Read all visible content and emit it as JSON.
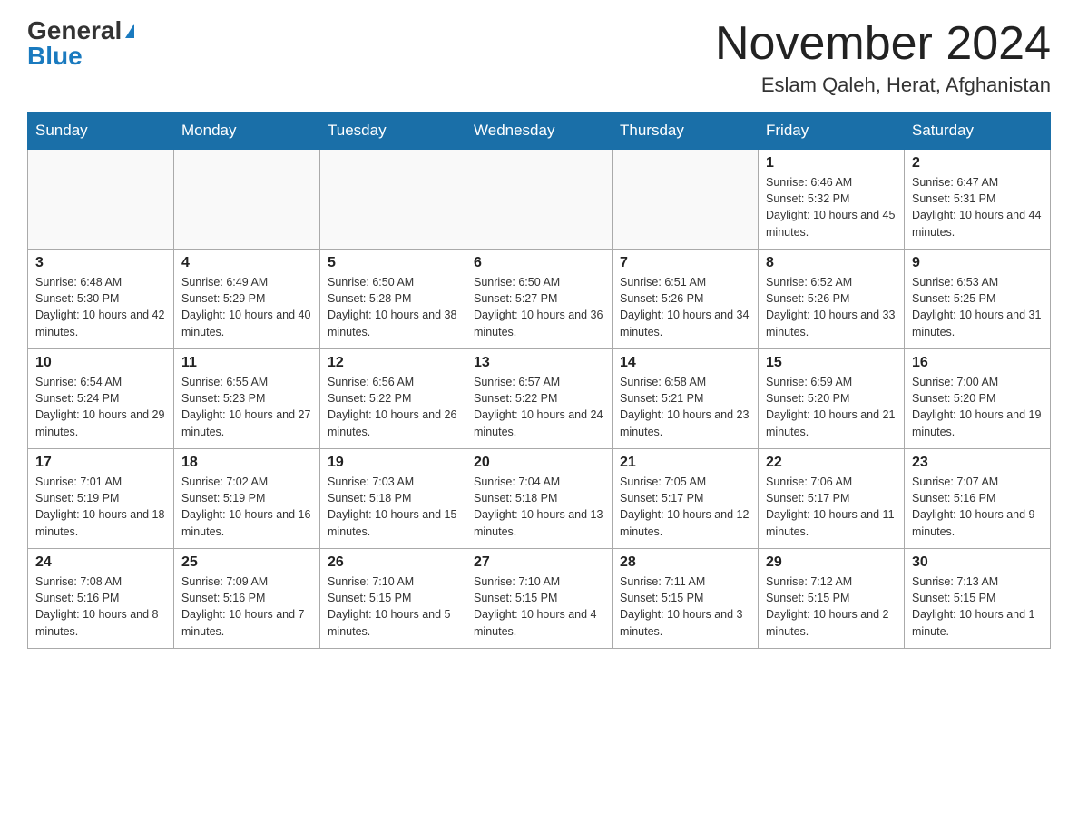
{
  "header": {
    "logo_general": "General",
    "logo_blue": "Blue",
    "month_title": "November 2024",
    "location": "Eslam Qaleh, Herat, Afghanistan"
  },
  "weekdays": [
    "Sunday",
    "Monday",
    "Tuesday",
    "Wednesday",
    "Thursday",
    "Friday",
    "Saturday"
  ],
  "weeks": [
    [
      {
        "day": "",
        "info": ""
      },
      {
        "day": "",
        "info": ""
      },
      {
        "day": "",
        "info": ""
      },
      {
        "day": "",
        "info": ""
      },
      {
        "day": "",
        "info": ""
      },
      {
        "day": "1",
        "info": "Sunrise: 6:46 AM\nSunset: 5:32 PM\nDaylight: 10 hours and 45 minutes."
      },
      {
        "day": "2",
        "info": "Sunrise: 6:47 AM\nSunset: 5:31 PM\nDaylight: 10 hours and 44 minutes."
      }
    ],
    [
      {
        "day": "3",
        "info": "Sunrise: 6:48 AM\nSunset: 5:30 PM\nDaylight: 10 hours and 42 minutes."
      },
      {
        "day": "4",
        "info": "Sunrise: 6:49 AM\nSunset: 5:29 PM\nDaylight: 10 hours and 40 minutes."
      },
      {
        "day": "5",
        "info": "Sunrise: 6:50 AM\nSunset: 5:28 PM\nDaylight: 10 hours and 38 minutes."
      },
      {
        "day": "6",
        "info": "Sunrise: 6:50 AM\nSunset: 5:27 PM\nDaylight: 10 hours and 36 minutes."
      },
      {
        "day": "7",
        "info": "Sunrise: 6:51 AM\nSunset: 5:26 PM\nDaylight: 10 hours and 34 minutes."
      },
      {
        "day": "8",
        "info": "Sunrise: 6:52 AM\nSunset: 5:26 PM\nDaylight: 10 hours and 33 minutes."
      },
      {
        "day": "9",
        "info": "Sunrise: 6:53 AM\nSunset: 5:25 PM\nDaylight: 10 hours and 31 minutes."
      }
    ],
    [
      {
        "day": "10",
        "info": "Sunrise: 6:54 AM\nSunset: 5:24 PM\nDaylight: 10 hours and 29 minutes."
      },
      {
        "day": "11",
        "info": "Sunrise: 6:55 AM\nSunset: 5:23 PM\nDaylight: 10 hours and 27 minutes."
      },
      {
        "day": "12",
        "info": "Sunrise: 6:56 AM\nSunset: 5:22 PM\nDaylight: 10 hours and 26 minutes."
      },
      {
        "day": "13",
        "info": "Sunrise: 6:57 AM\nSunset: 5:22 PM\nDaylight: 10 hours and 24 minutes."
      },
      {
        "day": "14",
        "info": "Sunrise: 6:58 AM\nSunset: 5:21 PM\nDaylight: 10 hours and 23 minutes."
      },
      {
        "day": "15",
        "info": "Sunrise: 6:59 AM\nSunset: 5:20 PM\nDaylight: 10 hours and 21 minutes."
      },
      {
        "day": "16",
        "info": "Sunrise: 7:00 AM\nSunset: 5:20 PM\nDaylight: 10 hours and 19 minutes."
      }
    ],
    [
      {
        "day": "17",
        "info": "Sunrise: 7:01 AM\nSunset: 5:19 PM\nDaylight: 10 hours and 18 minutes."
      },
      {
        "day": "18",
        "info": "Sunrise: 7:02 AM\nSunset: 5:19 PM\nDaylight: 10 hours and 16 minutes."
      },
      {
        "day": "19",
        "info": "Sunrise: 7:03 AM\nSunset: 5:18 PM\nDaylight: 10 hours and 15 minutes."
      },
      {
        "day": "20",
        "info": "Sunrise: 7:04 AM\nSunset: 5:18 PM\nDaylight: 10 hours and 13 minutes."
      },
      {
        "day": "21",
        "info": "Sunrise: 7:05 AM\nSunset: 5:17 PM\nDaylight: 10 hours and 12 minutes."
      },
      {
        "day": "22",
        "info": "Sunrise: 7:06 AM\nSunset: 5:17 PM\nDaylight: 10 hours and 11 minutes."
      },
      {
        "day": "23",
        "info": "Sunrise: 7:07 AM\nSunset: 5:16 PM\nDaylight: 10 hours and 9 minutes."
      }
    ],
    [
      {
        "day": "24",
        "info": "Sunrise: 7:08 AM\nSunset: 5:16 PM\nDaylight: 10 hours and 8 minutes."
      },
      {
        "day": "25",
        "info": "Sunrise: 7:09 AM\nSunset: 5:16 PM\nDaylight: 10 hours and 7 minutes."
      },
      {
        "day": "26",
        "info": "Sunrise: 7:10 AM\nSunset: 5:15 PM\nDaylight: 10 hours and 5 minutes."
      },
      {
        "day": "27",
        "info": "Sunrise: 7:10 AM\nSunset: 5:15 PM\nDaylight: 10 hours and 4 minutes."
      },
      {
        "day": "28",
        "info": "Sunrise: 7:11 AM\nSunset: 5:15 PM\nDaylight: 10 hours and 3 minutes."
      },
      {
        "day": "29",
        "info": "Sunrise: 7:12 AM\nSunset: 5:15 PM\nDaylight: 10 hours and 2 minutes."
      },
      {
        "day": "30",
        "info": "Sunrise: 7:13 AM\nSunset: 5:15 PM\nDaylight: 10 hours and 1 minute."
      }
    ]
  ]
}
